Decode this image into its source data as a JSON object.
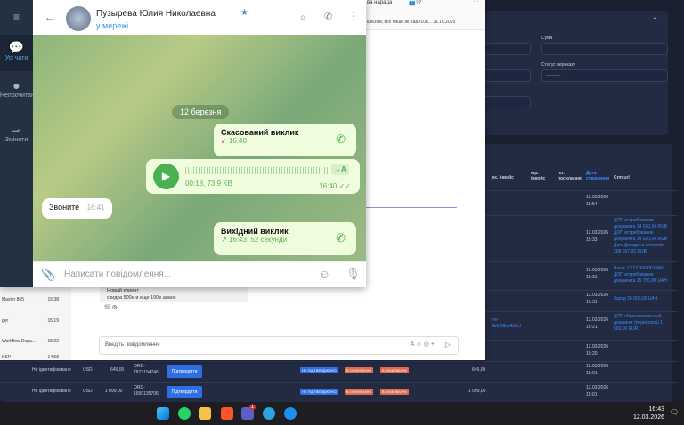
{
  "telegram": {
    "sidebar": [
      {
        "label": "Усі чати",
        "icon": "chats-icon"
      },
      {
        "label": "Непрочитано",
        "icon": "user-icon"
      },
      {
        "label": "Змінити",
        "icon": "sliders-icon"
      }
    ],
    "contact_name": "Пузырева Юлия Николаевна",
    "status": "у мережі",
    "date_separator": "12 березня",
    "messages": [
      {
        "type": "call",
        "title": "Скасований виклик",
        "meta": "16:40",
        "direction": "missed"
      },
      {
        "type": "voice",
        "duration": "00:18, 73,9 KB",
        "time": "16:40",
        "transcribe": "→A"
      },
      {
        "type": "text",
        "text": "Звоните",
        "time": "16:41"
      },
      {
        "type": "call",
        "title": "Вихідний виклик",
        "meta": "16:43, 52 секунди",
        "direction": "outgoing"
      }
    ],
    "input_placeholder": "Написати повідомлення..."
  },
  "teams": {
    "title_fragment": "ва нарада",
    "participants": "27",
    "pinned": "клієнти, все пише як на&#108... 31.10.2025",
    "chats": [
      {
        "name": "Master 865",
        "time": "15:38"
      },
      {
        "name": "ger",
        "time": "15:19"
      },
      {
        "name": "Workflow Depa...",
        "time": "15:02"
      },
      {
        "name": "KSP",
        "time": "14:58"
      }
    ],
    "message_lines": [
      "Новый клиент",
      "скидка 500е и еще 100е аванс"
    ],
    "input_placeholder": "Введіть повідомлення"
  },
  "admin": {
    "filters": {
      "sum_label": "Сума",
      "status_label": "Статус переказу",
      "status_value": "----------"
    },
    "headers": [
      "вх. інвойс",
      "юр. інвойс",
      "пл. посилання",
      "Дата створення",
      "Crm url"
    ],
    "rows": [
      {
        "date": "12.03.2026",
        "time": "15:54",
        "val": "0",
        "crm": []
      },
      {
        "date": "12.03.2026",
        "time": "15:33",
        "val": "0",
        "crm": [
          "ДОП истребование документа 14 020,04 RUB",
          "ДОП истребование документа 14 020,04 RUB",
          "Доп. Доподача Аттестат 208 697,92 RUB"
        ]
      },
      {
        "date": "12.03.2026",
        "time": "15:31",
        "val": "0",
        "crm": [
          "Часть 2 113 300,00 UAH",
          "ДОП истребование документа 25 750,00 UAH"
        ]
      },
      {
        "date": "12.03.2026",
        "time": "15:31",
        "val": "0",
        "crm": [
          "Заход 26 000,00 UAH"
        ]
      },
      {
        "date": "12.03.2026",
        "time": "15:21",
        "val": "0",
        "invoice": "inv-8b1f06be4b0cl",
        "crm": [
          "ДОП образовательный документ (переплата) 1 500,00 EUR"
        ]
      },
      {
        "date": "12.03.2026",
        "time": "15:20",
        "val": "0",
        "crm": []
      },
      {
        "date": "12.03.2026",
        "time": "15:01",
        "status": "Не ідентифіковано",
        "currency": "USD",
        "amount": "645,00",
        "order": "ORD-7877194746",
        "button": "Підтвердити",
        "tags": [
          "НЕ ПІДТВЕРДЖЕНО",
          "В ОЧІКУВАННІ",
          "В ОЧІКУВАННІ"
        ],
        "val": "645,00",
        "crm": []
      },
      {
        "date": "12.03.2026",
        "time": "15:01",
        "status": "Не ідентифіковано",
        "currency": "USD",
        "amount": "1 099,00",
        "order": "ORD-1650135706",
        "button": "Підтвердити",
        "tags": [
          "НЕ ПІДТВЕРДЖЕНО",
          "В ОЧІКУВАННІ",
          "В ОЧІКУВАННІ"
        ],
        "val": "1 099,00",
        "crm": []
      }
    ]
  },
  "taskbar": {
    "time": "16:43",
    "date": "12.03.2026",
    "apps": [
      "windows-start",
      "whatsapp",
      "file-explorer",
      "brave",
      "teams",
      "telegram",
      "messenger"
    ],
    "teams_badge": "1"
  },
  "colors": {
    "telegram_sidebar": "#243143",
    "bubble_out": "#effdde",
    "accent_green": "#4caf50",
    "admin_bg": "#1b2030",
    "link_blue": "#3d8bff"
  }
}
